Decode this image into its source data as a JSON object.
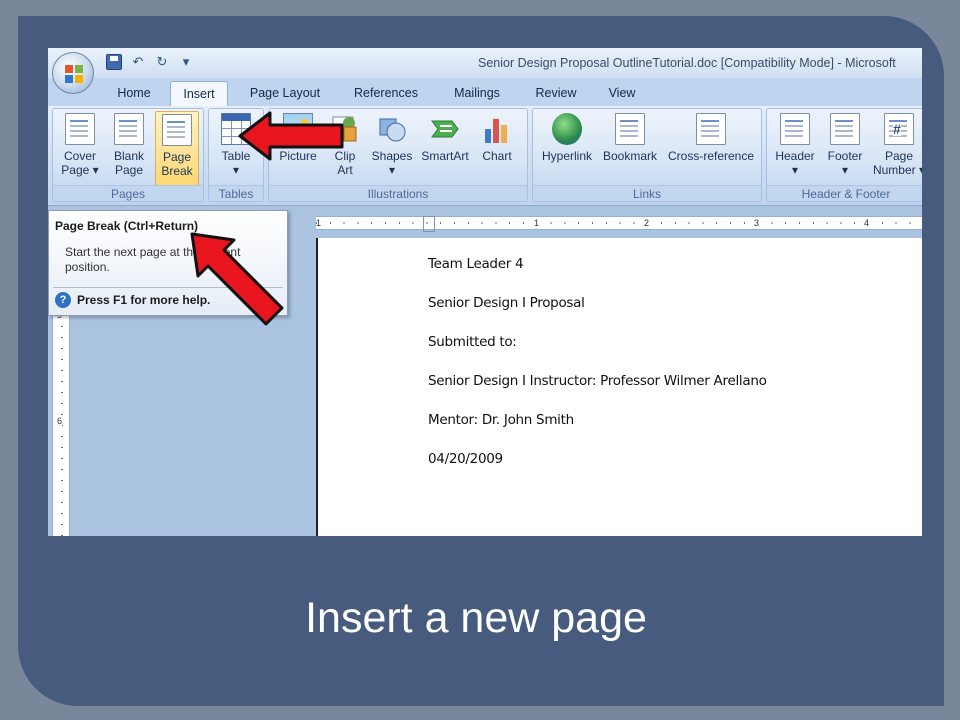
{
  "window": {
    "title": "Senior Design Proposal OutlineTutorial.doc [Compatibility Mode] - Microsoft"
  },
  "quick_access": {
    "customize": "▾"
  },
  "tabs": [
    {
      "label": "Home"
    },
    {
      "label": "Insert"
    },
    {
      "label": "Page Layout"
    },
    {
      "label": "References"
    },
    {
      "label": "Mailings"
    },
    {
      "label": "Review"
    },
    {
      "label": "View"
    }
  ],
  "ribbon": {
    "groups": {
      "pages": "Pages",
      "tables": "Tables",
      "illustrations": "Illustrations",
      "links": "Links",
      "header_footer": "Header & Footer"
    },
    "buttons": {
      "cover_page": [
        "Cover",
        "Page ▾"
      ],
      "blank_page": [
        "Blank",
        "Page"
      ],
      "page_break": [
        "Page",
        "Break"
      ],
      "table": [
        "Table",
        "▾"
      ],
      "picture": [
        "Picture",
        ""
      ],
      "clip_art": [
        "Clip",
        "Art"
      ],
      "shapes": [
        "Shapes",
        "▾"
      ],
      "smartart": [
        "SmartArt",
        ""
      ],
      "chart": [
        "Chart",
        ""
      ],
      "hyperlink": [
        "Hyperlink",
        ""
      ],
      "bookmark": [
        "Bookmark",
        ""
      ],
      "cross_reference": [
        "Cross-reference",
        ""
      ],
      "header": [
        "Header",
        "▾"
      ],
      "footer": [
        "Footer",
        "▾"
      ],
      "page_number": [
        "Page",
        "Number ▾"
      ]
    },
    "icons": {
      "cover_page": "cover-page-icon",
      "blank_page": "blank-page-icon",
      "page_break": "page-break-icon",
      "table": "table-icon",
      "picture": "picture-icon",
      "clip_art": "clip-art-icon",
      "shapes": "shapes-icon",
      "smartart": "smartart-icon",
      "chart": "chart-icon",
      "hyperlink": "hyperlink-globe-icon",
      "bookmark": "bookmark-icon",
      "cross_reference": "cross-reference-icon",
      "header": "header-icon",
      "footer": "footer-icon",
      "page_number": "page-number-icon"
    },
    "page_number_glyph": "#"
  },
  "tooltip": {
    "title": "Page Break (Ctrl+Return)",
    "body": "Start the next page at the current position.",
    "help": "Press F1 for more help.",
    "help_glyph": "?"
  },
  "ruler": {
    "horizontal": [
      "1",
      "1",
      "2",
      "3",
      "4"
    ],
    "vertical": [
      "5",
      "6"
    ]
  },
  "document": {
    "lines": [
      "Team Leader 4",
      "Senior Design I Proposal",
      "Submitted to:",
      "Senior Design I Instructor: Professor Wilmer Arellano",
      "Mentor: Dr. John Smith",
      "04/20/2009"
    ]
  },
  "annotation_arrows": {
    "color": "#e8141e",
    "count": 2
  },
  "caption": "Insert a new page",
  "colors": {
    "slide_background": "#465b7e",
    "ribbon_highlight": "#fcd772",
    "arrow": "#e8141e"
  }
}
